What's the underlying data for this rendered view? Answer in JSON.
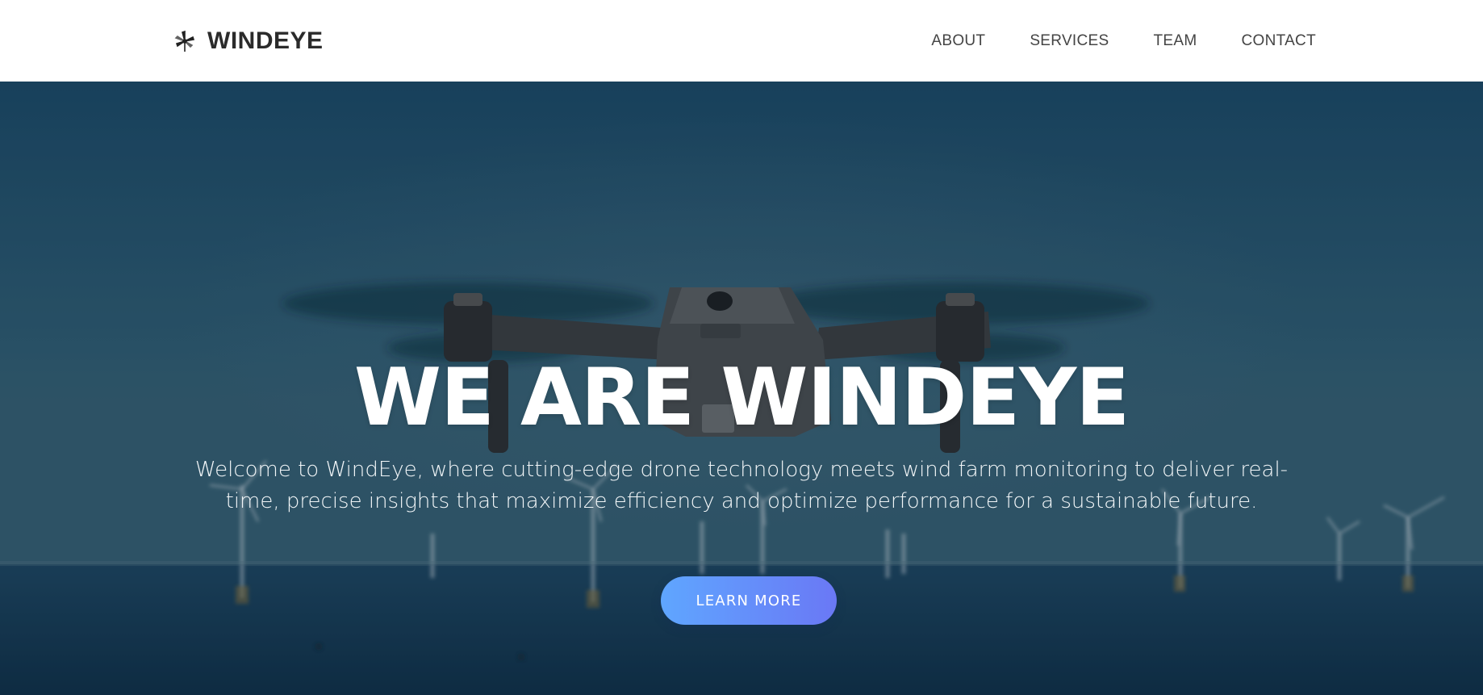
{
  "brand": {
    "icon": "windmill-icon",
    "name": "WINDEYE"
  },
  "nav": {
    "items": [
      {
        "label": "ABOUT"
      },
      {
        "label": "SERVICES"
      },
      {
        "label": "TEAM"
      },
      {
        "label": "CONTACT"
      }
    ]
  },
  "hero": {
    "title": "WE ARE WINDEYE",
    "subtitle": "Welcome to WindEye, where cutting-edge drone technology meets wind farm monitoring to deliver real-time, precise insights that maximize efficiency and optimize performance for a sustainable future.",
    "cta_label": "LEARN MORE",
    "background": "drone-over-offshore-wind-farm-photo"
  },
  "colors": {
    "nav_bg": "#ffffff",
    "brand_text": "#2b2b2b",
    "nav_text": "#444444",
    "hero_sky": "#26536c",
    "hero_sea": "#12344e",
    "cta_start": "#5fa6ff",
    "cta_end": "#6a78f5"
  }
}
